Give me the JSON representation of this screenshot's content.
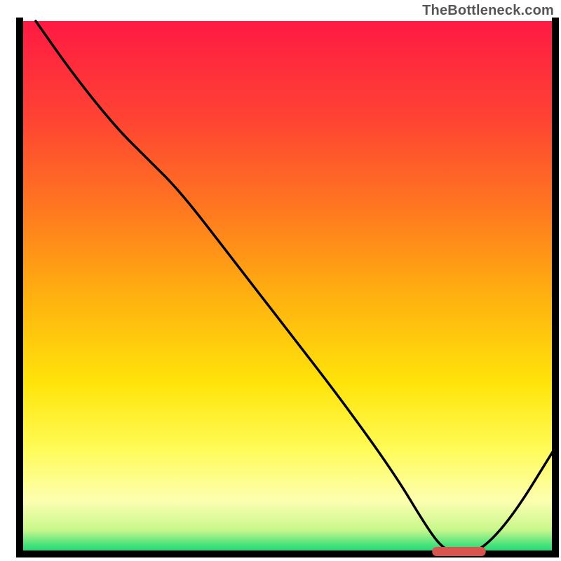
{
  "attribution": "TheBottleneck.com",
  "colors": {
    "frame": "#000000",
    "curve": "#000000",
    "marker_fill": "#d9534f",
    "gradient_stops": [
      {
        "offset": 0.0,
        "color": "#ff1a44"
      },
      {
        "offset": 0.18,
        "color": "#ff4233"
      },
      {
        "offset": 0.36,
        "color": "#ff7a1f"
      },
      {
        "offset": 0.52,
        "color": "#ffb20f"
      },
      {
        "offset": 0.68,
        "color": "#ffe40a"
      },
      {
        "offset": 0.8,
        "color": "#fffb55"
      },
      {
        "offset": 0.9,
        "color": "#fdffb0"
      },
      {
        "offset": 0.955,
        "color": "#c8f78c"
      },
      {
        "offset": 0.985,
        "color": "#3fe07a"
      },
      {
        "offset": 1.0,
        "color": "#17d36e"
      }
    ]
  },
  "chart_data": {
    "type": "line",
    "title": "",
    "xlabel": "",
    "ylabel": "",
    "xlim": [
      0,
      100
    ],
    "ylim": [
      0,
      100
    ],
    "grid": false,
    "legend": false,
    "comment": "Axes have no tick labels in the source image; values below are normalized 0–100 estimates read from the curve geometry relative to the plot frame. y is bottleneck / mismatch (0 = ideal, at the green band).",
    "x": [
      3,
      10,
      18,
      24,
      30,
      40,
      50,
      60,
      70,
      76,
      79,
      82,
      86,
      92,
      100
    ],
    "y": [
      100,
      90,
      80,
      74,
      68,
      55,
      42,
      29,
      15,
      5,
      1,
      0,
      0.5,
      7,
      20
    ],
    "optimal_marker": {
      "x_center": 82,
      "x_halfwidth": 5,
      "y": 0
    }
  }
}
